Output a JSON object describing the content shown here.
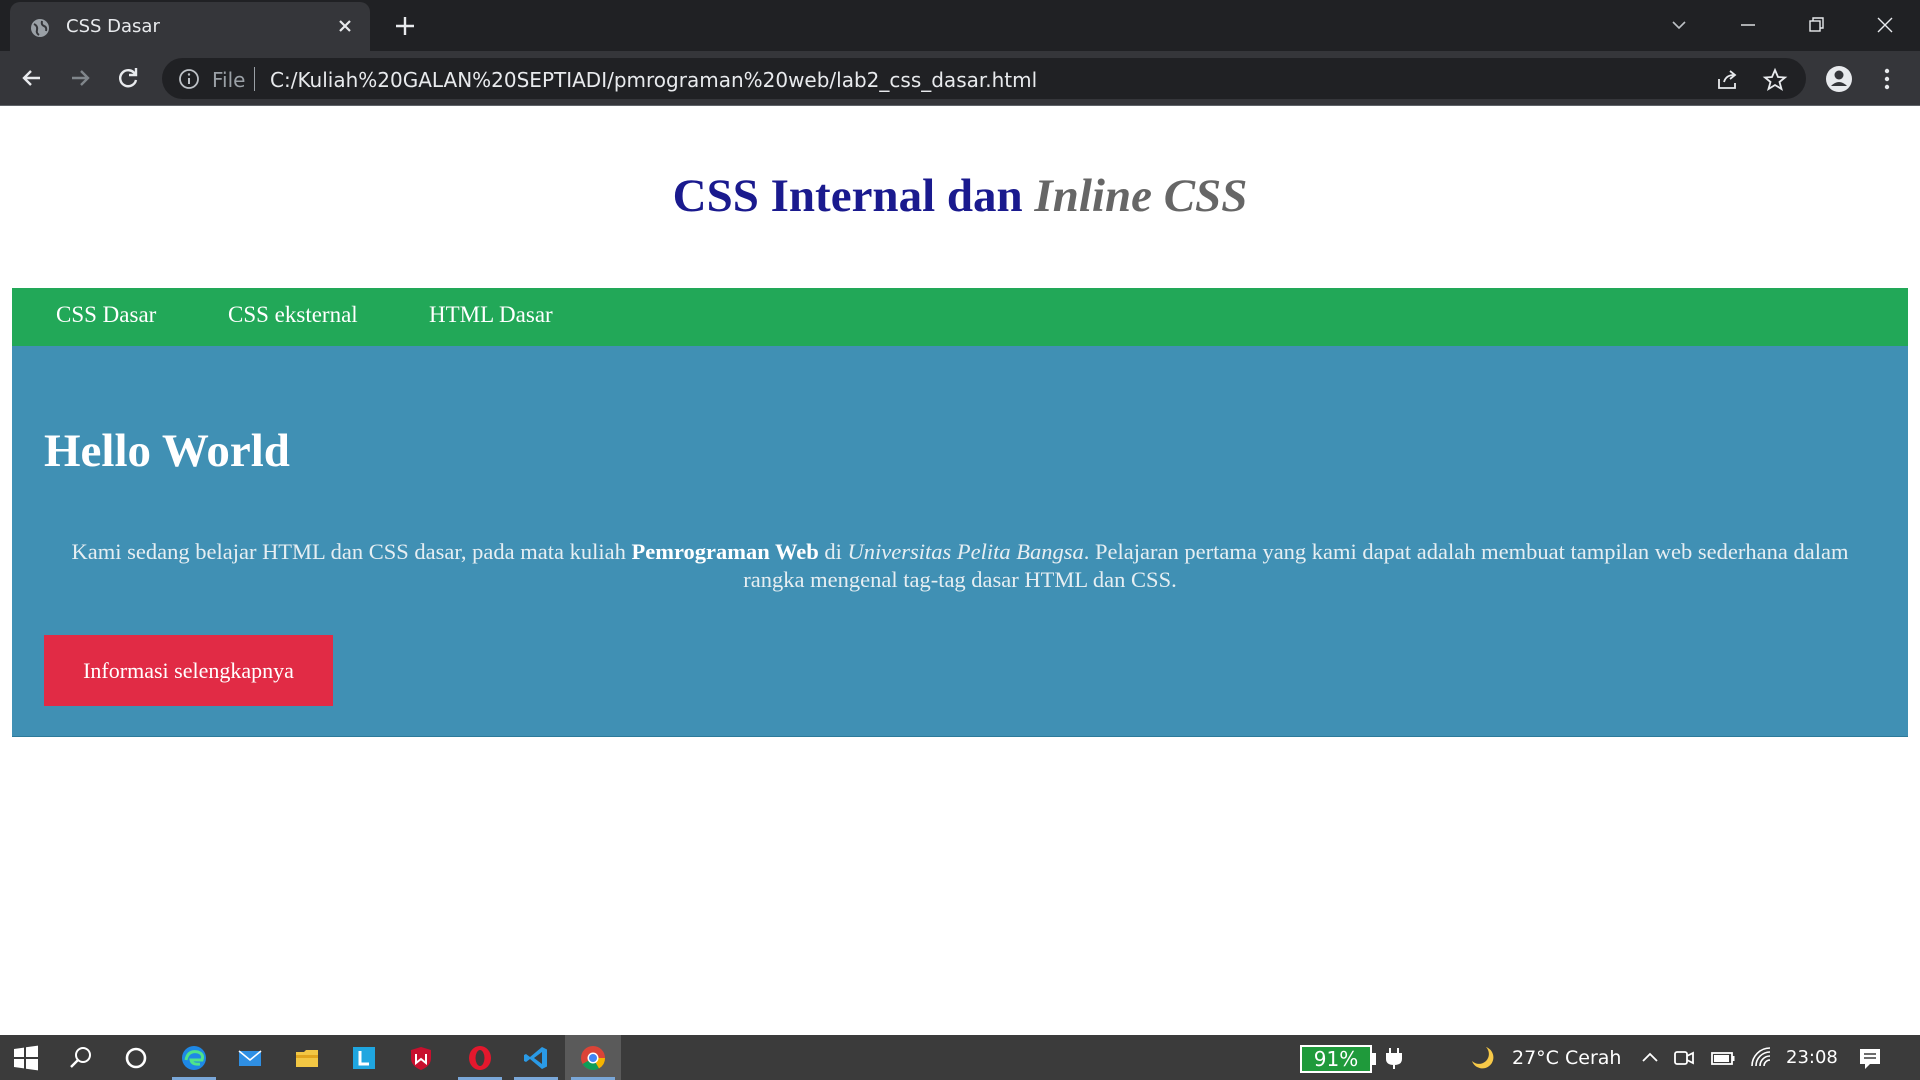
{
  "browser": {
    "tab_title": "CSS Dasar",
    "omnibox_scheme": "File",
    "url": "C:/Kuliah%20GALAN%20SEPTIADI/pmrograman%20web/lab2_css_dasar.html"
  },
  "page": {
    "title_main": "CSS Internal dan ",
    "title_italic": "Inline CSS",
    "menu": [
      "CSS Dasar",
      "CSS eksternal",
      "HTML Dasar"
    ],
    "hero": {
      "heading": "Hello World",
      "text_1": "Kami sedang belajar HTML dan CSS dasar, pada mata kuliah ",
      "text_bold": "Pemrograman Web",
      "text_2": " di ",
      "text_italic": "Universitas Pelita Bangsa",
      "text_3": ". Pelajaran pertama yang kami dapat adalah membuat tampilan web sederhana dalam rangka mengenal tag-tag dasar HTML dan CSS.",
      "button_label": "Informasi selengkapnya"
    }
  },
  "taskbar": {
    "battery": "91%",
    "weather": "27°C  Cerah",
    "time": "23:08"
  },
  "colors": {
    "menu_bg": "#22a858",
    "hero_bg": "#4090b4",
    "button_bg": "#e12b45",
    "title_color": "#1a1a8e"
  }
}
